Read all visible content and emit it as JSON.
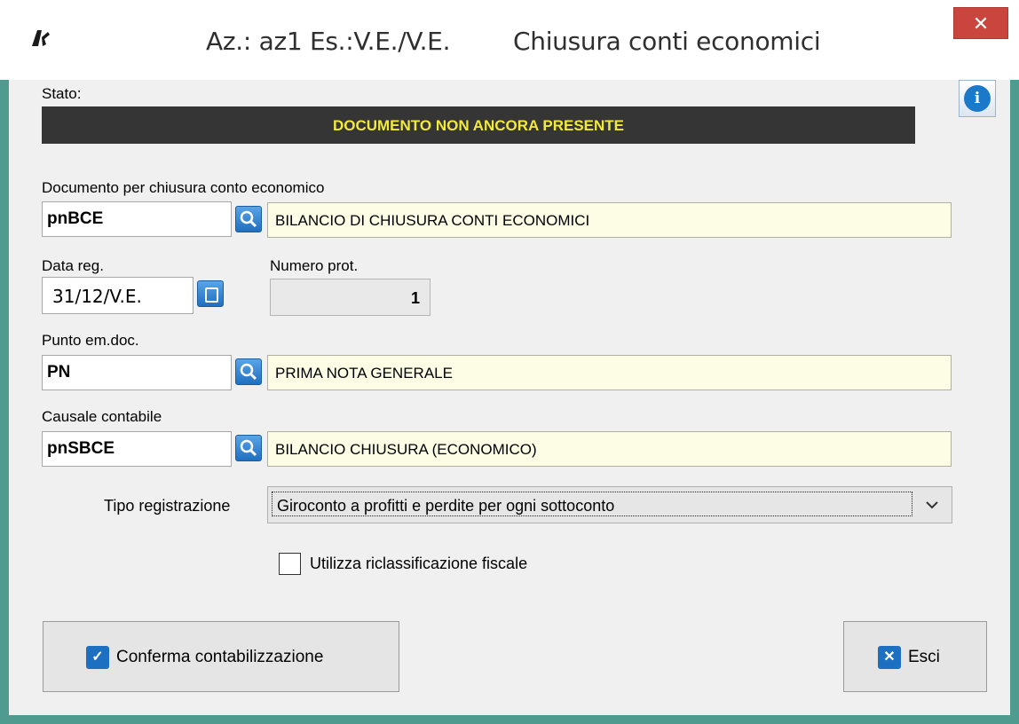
{
  "window": {
    "title_left": "Az.: az1 Es.:V.E./V.E.",
    "title_right": "Chiusura conti economici",
    "close_symbol": "✕",
    "accent_color": "#4f9b8f"
  },
  "status": {
    "label": "Stato:",
    "value": "DOCUMENTO NON ANCORA PRESENTE",
    "text_color": "#f2ea3a"
  },
  "info_button": {
    "icon": "info-bubble-icon",
    "glyph": "i"
  },
  "documento": {
    "label": "Documento per chiusura conto economico",
    "code": "pnBCE",
    "description": "BILANCIO DI CHIUSURA CONTI ECONOMICI"
  },
  "data_reg": {
    "label": "Data reg.",
    "value": "31/12/V.E."
  },
  "numero_prot": {
    "label": "Numero prot.",
    "value": "1"
  },
  "punto": {
    "label": "Punto em.doc.",
    "code": "PN",
    "description": "PRIMA NOTA GENERALE"
  },
  "causale": {
    "label": "Causale contabile",
    "code": "pnSBCE",
    "description": "BILANCIO CHIUSURA (ECONOMICO)"
  },
  "tipo_registrazione": {
    "label": "Tipo registrazione",
    "selected": "Giroconto a profitti e perdite per ogni sottoconto"
  },
  "riclassificazione": {
    "label": "Utilizza riclassificazione fiscale",
    "checked": false
  },
  "buttons": {
    "confirm_label": "Conferma contabilizzazione",
    "confirm_icon_glyph": "✓",
    "exit_label": "Esci",
    "exit_icon_glyph": "✕"
  }
}
